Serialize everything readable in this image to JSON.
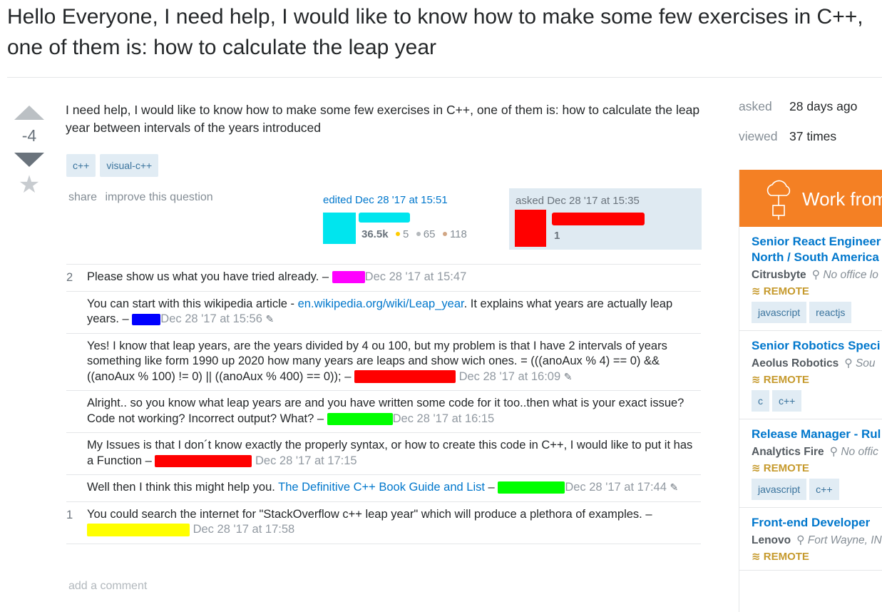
{
  "question": {
    "title": "Hello Everyone, I need help, I would like to know how to make some few exercises in C++, one of them is: how to calculate the leap year",
    "body": "I need help, I would like to know how to make some few exercises in C++, one of them is: how to calculate the leap year between intervals of the years introduced",
    "score": "-4",
    "tags": [
      "c++",
      "visual-c++"
    ],
    "menu": {
      "share": "share",
      "improve": "improve this question"
    },
    "edited": {
      "action": "edited Dec 28 '17 at 15:51",
      "reputation": "36.5k",
      "gold": "5",
      "silver": "65",
      "bronze": "118"
    },
    "asked": {
      "action": "asked Dec 28 '17 at 15:35",
      "reputation": "1"
    }
  },
  "comments": [
    {
      "score": "2",
      "text": "Please show us what you have tried already. –",
      "date": "Dec 28 '17 at 15:47"
    },
    {
      "score": "",
      "text_before": "You can start with this wikipedia article - ",
      "link": "en.wikipedia.org/wiki/Leap_year",
      "text_after": ". It explains what years are actually leap years. –",
      "date": "Dec 28 '17 at 15:56"
    },
    {
      "score": "",
      "text": "Yes! I know that leap years, are the years divided by 4 ou 100, but my problem is that I have 2 intervals of years something like form 1990 up 2020 how many years are leaps and show wich ones. = (((anoAux % 4) == 0) && ((anoAux % 100) != 0) || ((anoAux % 400) == 0)); –",
      "date": "Dec 28 '17 at 16:09"
    },
    {
      "score": "",
      "text": "Alright.. so you know what leap years are and you have written some code for it too..then what is your exact issue? Code not working? Incorrect output? What? –",
      "date": "Dec 28 '17 at 16:15"
    },
    {
      "score": "",
      "text": "My Issues is that I don´t know exactly the properly syntax, or how to create this code in C++, I would like to put it has a Function –",
      "date": "Dec 28 '17 at 17:15"
    },
    {
      "score": "",
      "text_before": "Well then I think this might help you. ",
      "link": "The Definitive C++ Book Guide and List",
      "text_after": " –",
      "date": "Dec 28 '17 at 17:44"
    },
    {
      "score": "1",
      "text": "You could search the internet for \"StackOverflow c++ leap year\" which will produce a plethora of examples. –",
      "date": "Dec 28 '17 at 17:58"
    }
  ],
  "add_comment": "add a comment",
  "meta": {
    "asked_label": "asked",
    "asked_value": "28 days ago",
    "viewed_label": "viewed",
    "viewed_value": "37 times"
  },
  "jobs": {
    "banner": "Work from",
    "remote_label": "REMOTE",
    "items": [
      {
        "title": "Senior React Engineer",
        "title2": "North / South America",
        "company": "Citrusbyte",
        "location": "No office lo",
        "tags": [
          "javascript",
          "reactjs"
        ]
      },
      {
        "title": "Senior Robotics Speci",
        "company": "Aeolus Robotics",
        "location": "Sou",
        "tags": [
          "c",
          "c++"
        ]
      },
      {
        "title": "Release Manager - Rul",
        "company": "Analytics Fire",
        "location": "No offic",
        "tags": [
          "javascript",
          "c++"
        ]
      },
      {
        "title": "Front-end Developer",
        "company": "Lenovo",
        "location": "Fort Wayne, IN",
        "tags": []
      }
    ]
  },
  "colors": {
    "link": "#0077cc",
    "tag_bg": "#e1ecf4",
    "tag_text": "#39739d",
    "banner": "#f48024",
    "remote": "#c69a2d"
  }
}
